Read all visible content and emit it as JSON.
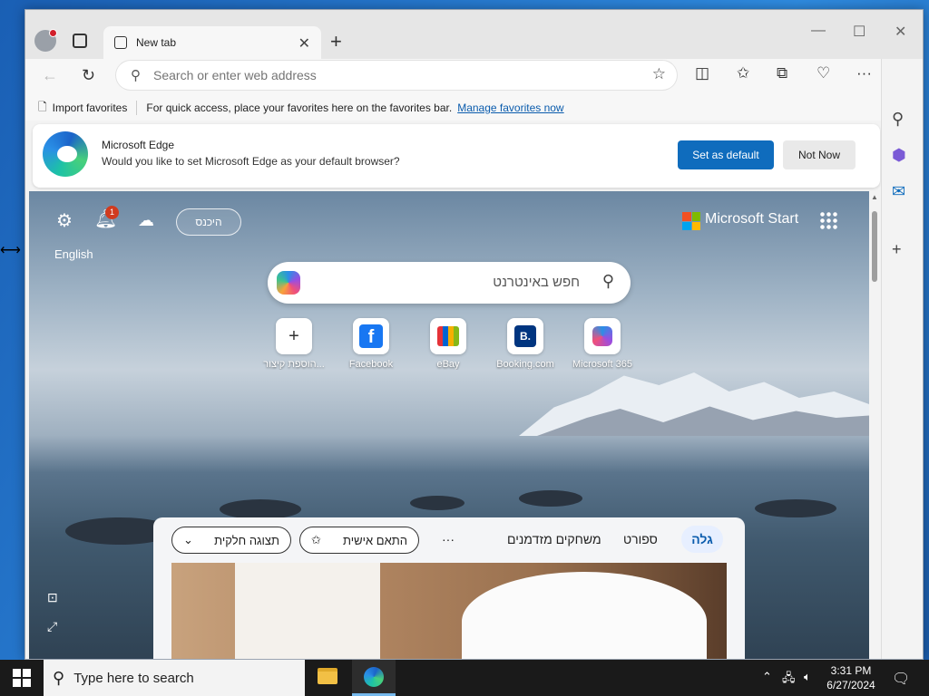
{
  "browser": {
    "tab_title": "New tab",
    "address_placeholder": "Search or enter web address"
  },
  "favorites_bar": {
    "import_label": "Import favorites",
    "hint": "For quick access, place your favorites here on the favorites bar.",
    "manage_link": "Manage favorites now"
  },
  "notification": {
    "title": "Microsoft Edge",
    "text": "Would you like to set Microsoft Edge as your default browser?",
    "primary_button": "Set as default",
    "secondary_button": "Not Now"
  },
  "newtab_page": {
    "sign_in": "היכנס",
    "notification_count": "1",
    "language": "English",
    "brand": "Microsoft Start",
    "search_placeholder": "חפש באינטרנט",
    "quick_links": [
      {
        "label": "הוספת קיצור...",
        "icon": "plus-icon"
      },
      {
        "label": "Facebook",
        "icon": "facebook-icon"
      },
      {
        "label": "eBay",
        "icon": "ebay-icon"
      },
      {
        "label": "Booking.com",
        "icon": "booking-icon"
      },
      {
        "label": "Microsoft 365",
        "icon": "m365-icon"
      }
    ]
  },
  "feed": {
    "tabs": [
      "גלה",
      "ספורט",
      "משחקים מזדמנים"
    ],
    "more": "···",
    "personalize": "התאם אישית",
    "view_mode": "תצוגה חלקית"
  },
  "taskbar": {
    "search_placeholder": "Type here to search",
    "time": "3:31 PM",
    "date": "6/27/2024"
  },
  "colors": {
    "accent": "#0f6cbd",
    "taskbar": "#1a1a1a",
    "notification_badge": "#d13b1f"
  }
}
